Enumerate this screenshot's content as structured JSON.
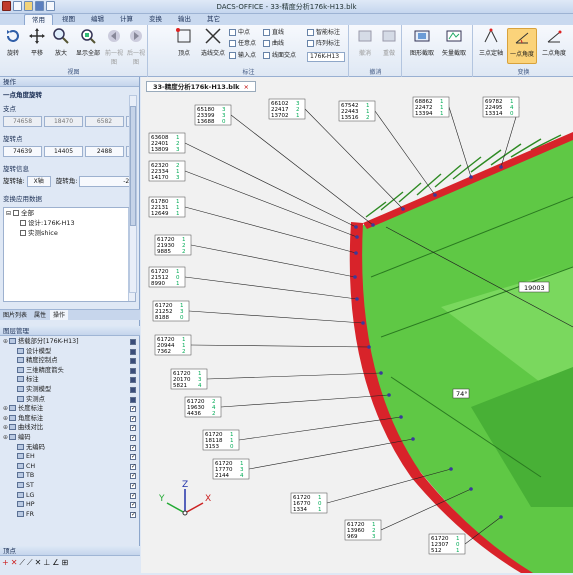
{
  "window": {
    "title": "DACS-OFFICE - 33-精度分析176k-H13.blk"
  },
  "ribbon_tabs": [
    "常用",
    "视图",
    "编辑",
    "计算",
    "变换",
    "输出",
    "其它"
  ],
  "groups": {
    "view": {
      "label": "视图",
      "buttons": [
        "旋转",
        "平移",
        "放大",
        "显示全部",
        "前一视图",
        "后一视图"
      ]
    },
    "mark": {
      "label": "标注",
      "buttons": [
        "顶点",
        "选线交点"
      ],
      "small": [
        "中点",
        "任意点",
        "输入点",
        "直线",
        "曲线",
        "线面交点",
        "智能标注",
        "阵列标注"
      ],
      "combo": "176K-H13"
    },
    "undo": {
      "label": "撤消",
      "buttons": [
        "撤消",
        "重做"
      ]
    },
    "cap": {
      "label": "",
      "buttons": [
        "图形截取",
        "矢量截取"
      ]
    },
    "transform": {
      "label": "变换",
      "buttons": [
        "三点定轴",
        "一点角度",
        "二点角度"
      ]
    }
  },
  "left": {
    "title": "操作",
    "sec1": "一点角度旋转",
    "support": "支点",
    "support_vals": [
      "74658",
      "18470",
      "6582"
    ],
    "rot_point": "旋转点",
    "rot_vals": [
      "74639",
      "14405",
      "2488"
    ],
    "rot_info": "旋转信息",
    "axis_label": "旋转轴:",
    "axis_val": "X轴",
    "angle_label": "旋转角:",
    "angle_val": "-20",
    "transform_data": "变换应用数据",
    "tree": {
      "root": "全部",
      "child1": "设计:176K-H13",
      "child2": "实测shice"
    },
    "tabs": [
      "图片列表",
      "属性",
      "操作"
    ],
    "layers_title": "图层管理",
    "layers": [
      {
        "name": "搭载部分[176K-H13]",
        "level": 0
      },
      {
        "name": "设计模型",
        "level": 1
      },
      {
        "name": "精度控制点",
        "level": 1
      },
      {
        "name": "三维精度箭头",
        "level": 1
      },
      {
        "name": "标注",
        "level": 1
      },
      {
        "name": "实测模型",
        "level": 1
      },
      {
        "name": "实测点",
        "level": 1
      },
      {
        "name": "长度标注",
        "level": 0
      },
      {
        "name": "角度标注",
        "level": 0
      },
      {
        "name": "曲线对比",
        "level": 0
      },
      {
        "name": "编码",
        "level": 0
      },
      {
        "name": "无编码",
        "level": 1
      },
      {
        "name": "EH",
        "level": 1
      },
      {
        "name": "CH",
        "level": 1
      },
      {
        "name": "TB",
        "level": 1
      },
      {
        "name": "ST",
        "level": 1
      },
      {
        "name": "LG",
        "level": 1
      },
      {
        "name": "HP",
        "level": 1
      },
      {
        "name": "FR",
        "level": 1
      }
    ],
    "bottom_title": "顶点"
  },
  "doc_tab": "33-精度分析176k-H13.blk",
  "viewport": {
    "dims": {
      "d1": "19003",
      "angle": "74°"
    },
    "axes": [
      "X",
      "Y",
      "Z"
    ],
    "labels": [
      {
        "a": "65180",
        "b": "23399",
        "c": "13688",
        "d": [
          "3",
          "3",
          "0"
        ]
      },
      {
        "a": "66102",
        "b": "22417",
        "c": "13702",
        "d": [
          "3",
          "2",
          "1"
        ]
      },
      {
        "a": "67542",
        "b": "22443",
        "c": "13516",
        "d": [
          "1",
          "1",
          "2"
        ]
      },
      {
        "a": "68862",
        "b": "22472",
        "c": "13394",
        "d": [
          "1",
          "1",
          "1"
        ]
      },
      {
        "a": "69782",
        "b": "22495",
        "c": "13314",
        "d": [
          "1",
          "4",
          "0"
        ]
      },
      {
        "a": "63608",
        "b": "22401",
        "c": "13809",
        "d": [
          "1",
          "2",
          "3"
        ]
      },
      {
        "a": "62320",
        "b": "22334",
        "c": "14170",
        "d": [
          "2",
          "1",
          "3"
        ]
      },
      {
        "a": "61780",
        "b": "22131",
        "c": "12649",
        "d": [
          "1",
          "1",
          "1"
        ]
      },
      {
        "a": "61720",
        "b": "21930",
        "c": "9885",
        "d": [
          "1",
          "2",
          "2"
        ]
      },
      {
        "a": "61720",
        "b": "21512",
        "c": "8990",
        "d": [
          "1",
          "0",
          "1"
        ]
      },
      {
        "a": "61720",
        "b": "21252",
        "c": "8188",
        "d": [
          "1",
          "3",
          "0"
        ]
      },
      {
        "a": "61720",
        "b": "20944",
        "c": "7362",
        "d": [
          "1",
          "1",
          "2"
        ]
      },
      {
        "a": "61720",
        "b": "20170",
        "c": "5821",
        "d": [
          "1",
          "3",
          "4"
        ]
      },
      {
        "a": "61720",
        "b": "19630",
        "c": "4436",
        "d": [
          "2",
          "4",
          "2"
        ]
      },
      {
        "a": "61720",
        "b": "18118",
        "c": "3153",
        "d": [
          "1",
          "1",
          "0"
        ]
      },
      {
        "a": "61720",
        "b": "17770",
        "c": "2144",
        "d": [
          "1",
          "3",
          "4"
        ]
      },
      {
        "a": "61720",
        "b": "16770",
        "c": "1334",
        "d": [
          "1",
          "0",
          "1"
        ]
      },
      {
        "a": "61720",
        "b": "13960",
        "c": "969",
        "d": [
          "1",
          "2",
          "3"
        ]
      },
      {
        "a": "61720",
        "b": "12307",
        "c": "512",
        "d": [
          "1",
          "0",
          "1"
        ]
      }
    ]
  },
  "colors": {
    "green": "#5fc845",
    "darkgreen": "#3f9a2e",
    "red": "#d8232a",
    "darkred": "#8e1218"
  }
}
